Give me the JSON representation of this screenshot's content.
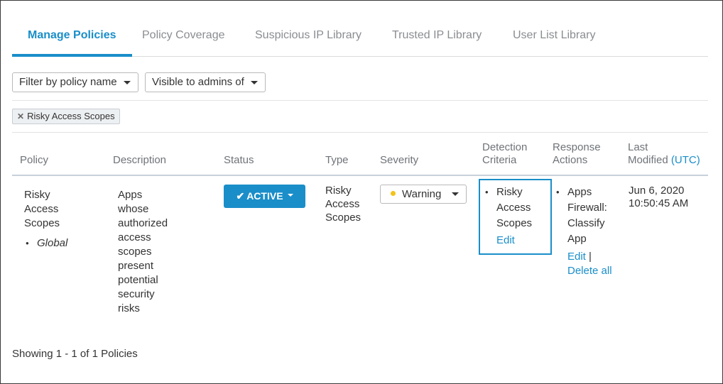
{
  "tabs": [
    {
      "label": "Manage Policies",
      "active": true
    },
    {
      "label": "Policy Coverage",
      "active": false
    },
    {
      "label": "Suspicious IP Library",
      "active": false
    },
    {
      "label": "Trusted IP Library",
      "active": false
    },
    {
      "label": "User List Library",
      "active": false
    }
  ],
  "filters": {
    "policy_name": "Filter by policy name",
    "visible_to": "Visible to admins of"
  },
  "chip": {
    "label": "Risky Access Scopes",
    "remove_icon": "close-icon"
  },
  "table": {
    "headers": {
      "policy": "Policy",
      "description": "Description",
      "status": "Status",
      "type": "Type",
      "severity": "Severity",
      "detection_line1": "Detection",
      "detection_line2": "Criteria",
      "response_line1": "Response",
      "response_line2": "Actions",
      "modified_line1": "Last",
      "modified_line2": "Modified",
      "modified_utc": "(UTC)"
    },
    "row": {
      "policy_name": [
        "Risky",
        "Access",
        "Scopes"
      ],
      "policy_scope": "Global",
      "description": [
        "Apps",
        "whose",
        "authorized",
        "access",
        "scopes",
        "present",
        "potential",
        "security",
        "risks"
      ],
      "status": "ACTIVE",
      "type": [
        "Risky",
        "Access",
        "Scopes"
      ],
      "severity": "Warning",
      "severity_color": "#f2c31a",
      "detection": [
        "Risky",
        "Access",
        "Scopes"
      ],
      "detection_edit": "Edit",
      "response": [
        "Apps",
        "Firewall:",
        "Classify",
        "App"
      ],
      "response_edit": "Edit",
      "response_sep": "|",
      "response_delete": "Delete all",
      "modified_date": "Jun 6, 2020",
      "modified_time": "10:50:45 AM"
    }
  },
  "footer": "Showing 1 - 1 of 1 Policies",
  "colors": {
    "accent": "#1a8ec9",
    "warning": "#f2c31a"
  }
}
